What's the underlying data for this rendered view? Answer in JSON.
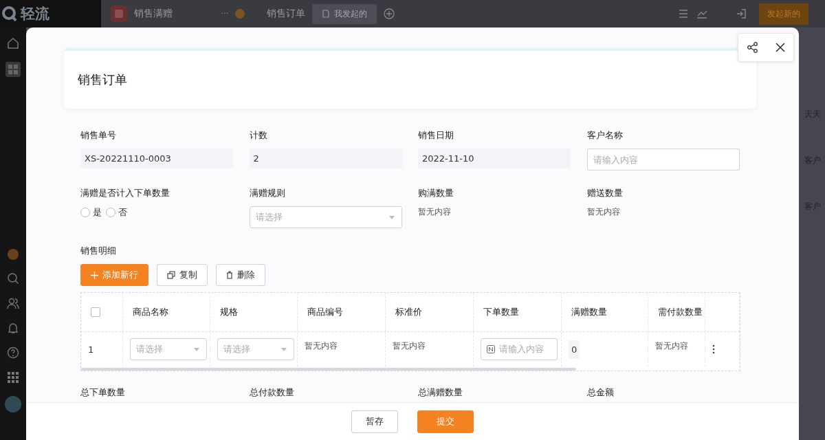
{
  "topbar": {
    "logo": "轻流",
    "app_name": "销售满赠",
    "more": "···",
    "page_title": "销售订单",
    "views": [
      {
        "label": "我发起的",
        "selected": true
      }
    ],
    "action_button": "发起新的"
  },
  "background_fragments": [
    "天天",
    "客户",
    "客户"
  ],
  "modal": {
    "title": "销售订单",
    "fields": [
      {
        "label": "销售单号",
        "kind": "readonly",
        "value": "XS-20221110-0003"
      },
      {
        "label": "计数",
        "kind": "readonly",
        "value": "2"
      },
      {
        "label": "销售日期",
        "kind": "readonly",
        "value": "2022-11-10"
      },
      {
        "label": "客户名称",
        "kind": "input",
        "placeholder": "请输入内容"
      },
      {
        "label": "满赠是否计入下单数量",
        "kind": "radio",
        "options": [
          {
            "label": "是",
            "selected": false
          },
          {
            "label": "否",
            "selected": false
          }
        ]
      },
      {
        "label": "满赠规则",
        "kind": "select",
        "placeholder": "请选择"
      },
      {
        "label": "购满数量",
        "kind": "empty",
        "value": "暂无内容"
      },
      {
        "label": "赠送数量",
        "kind": "empty",
        "value": "暂无内容"
      }
    ],
    "detail": {
      "title": "销售明细",
      "buttons": [
        {
          "label": "添加新行",
          "kind": "primary"
        },
        {
          "label": "复制",
          "kind": "copy"
        },
        {
          "label": "删除",
          "kind": "delete"
        }
      ],
      "header_checked": false,
      "columns": [
        "商品名称",
        "规格",
        "商品编号",
        "标准价",
        "下单数量",
        "满赠数量",
        "需付款数量"
      ],
      "rows": [
        {
          "index": "1",
          "cells": [
            {
              "kind": "select",
              "placeholder": "请选择"
            },
            {
              "kind": "select",
              "placeholder": "请选择"
            },
            {
              "kind": "text",
              "value": "暂无内容"
            },
            {
              "kind": "text",
              "value": "暂无内容"
            },
            {
              "kind": "input",
              "placeholder": "请输入内容"
            },
            {
              "kind": "readonly",
              "value": "0"
            },
            {
              "kind": "text",
              "value": "暂无内容"
            }
          ]
        }
      ]
    },
    "summary": [
      "总下单数量",
      "总付款数量",
      "总满赠数量",
      "总金额"
    ],
    "footer_buttons": [
      {
        "label": "暂存",
        "kind": "default"
      },
      {
        "label": "提交",
        "kind": "primary"
      }
    ]
  }
}
